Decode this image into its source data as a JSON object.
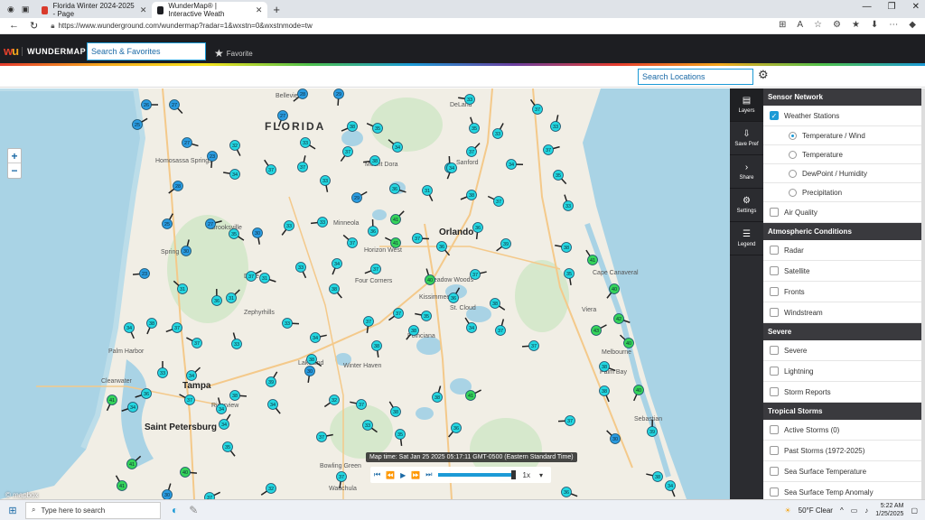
{
  "browser": {
    "tabs": [
      {
        "title": "Florida Winter 2024-2025 - Page",
        "active": false,
        "favicon_color": "#d93a2b"
      },
      {
        "title": "WunderMap® | Interactive Weath",
        "active": true,
        "favicon_color": "#1d1e22"
      }
    ],
    "url": "https://www.wunderground.com/wundermap?radar=1&wxstn=0&wxstnmode=tw"
  },
  "header": {
    "brand": "WUNDERMAP",
    "search_placeholder": "Search & Favorites",
    "favorite_label": "Favorite"
  },
  "subbar": {
    "search_locations_placeholder": "Search Locations"
  },
  "map": {
    "state_label": "FLORIDA",
    "attribution": "© mapbox",
    "time_label": "Map time: Sat Jan 25 2025 05:17:11 GMT-0500 (Eastern Standard Time)",
    "speed": "1x",
    "cities": [
      "Belleview",
      "DeLand",
      "Homosassa Springs",
      "Mount Dora",
      "Sanford",
      "Brooksville",
      "Minneola",
      "Horizon West",
      "Orlando",
      "Spring Hill",
      "Dade",
      "Four Corners",
      "Meadow Woods",
      "Cape Canaveral",
      "Kissimmee",
      "St. Cloud",
      "Zephyrhills",
      "Viera",
      "Palm Harbor",
      "Poinciana",
      "Melbourne",
      "Lakeland",
      "Winter Haven",
      "Palm Bay",
      "Clearwater",
      "Tampa",
      "Riverview",
      "Saint Petersburg",
      "Sebastian",
      "Bowling Green",
      "Wauchula"
    ]
  },
  "tools": [
    {
      "icon": "layers-icon",
      "label": "Layers"
    },
    {
      "icon": "save-icon",
      "label": "Save Pref"
    },
    {
      "icon": "share-icon",
      "label": "Share"
    },
    {
      "icon": "gear-icon",
      "label": "Settings"
    },
    {
      "icon": "legend-icon",
      "label": "Legend"
    }
  ],
  "panel": {
    "sections": [
      {
        "title": "Sensor Network",
        "items": [
          {
            "label": "Weather Stations",
            "checked": true
          },
          {
            "label": "Temperature / Wind",
            "radio": true,
            "checked": true
          },
          {
            "label": "Temperature",
            "radio": true,
            "checked": false
          },
          {
            "label": "DewPoint / Humidity",
            "radio": true,
            "checked": false
          },
          {
            "label": "Precipitation",
            "radio": true,
            "checked": false
          },
          {
            "label": "Air Quality",
            "checked": false
          }
        ]
      },
      {
        "title": "Atmospheric Conditions",
        "items": [
          {
            "label": "Radar",
            "checked": false
          },
          {
            "label": "Satellite",
            "checked": false
          },
          {
            "label": "Fronts",
            "checked": false
          },
          {
            "label": "Windstream",
            "checked": false
          }
        ]
      },
      {
        "title": "Severe",
        "items": [
          {
            "label": "Severe",
            "checked": false
          },
          {
            "label": "Lightning",
            "checked": false
          },
          {
            "label": "Storm Reports",
            "checked": false
          }
        ]
      },
      {
        "title": "Tropical Storms",
        "items": [
          {
            "label": "Active Storms (0)",
            "checked": false
          },
          {
            "label": "Past Storms (1972-2025)",
            "checked": false
          },
          {
            "label": "Sea Surface Temperature",
            "checked": false
          },
          {
            "label": "Sea Surface Temp Anomaly",
            "checked": false
          }
        ]
      }
    ]
  },
  "taskbar": {
    "search_placeholder": "Type here to search",
    "weather": "50°F  Clear",
    "time": "5:22 AM",
    "date": "1/25/2025"
  }
}
